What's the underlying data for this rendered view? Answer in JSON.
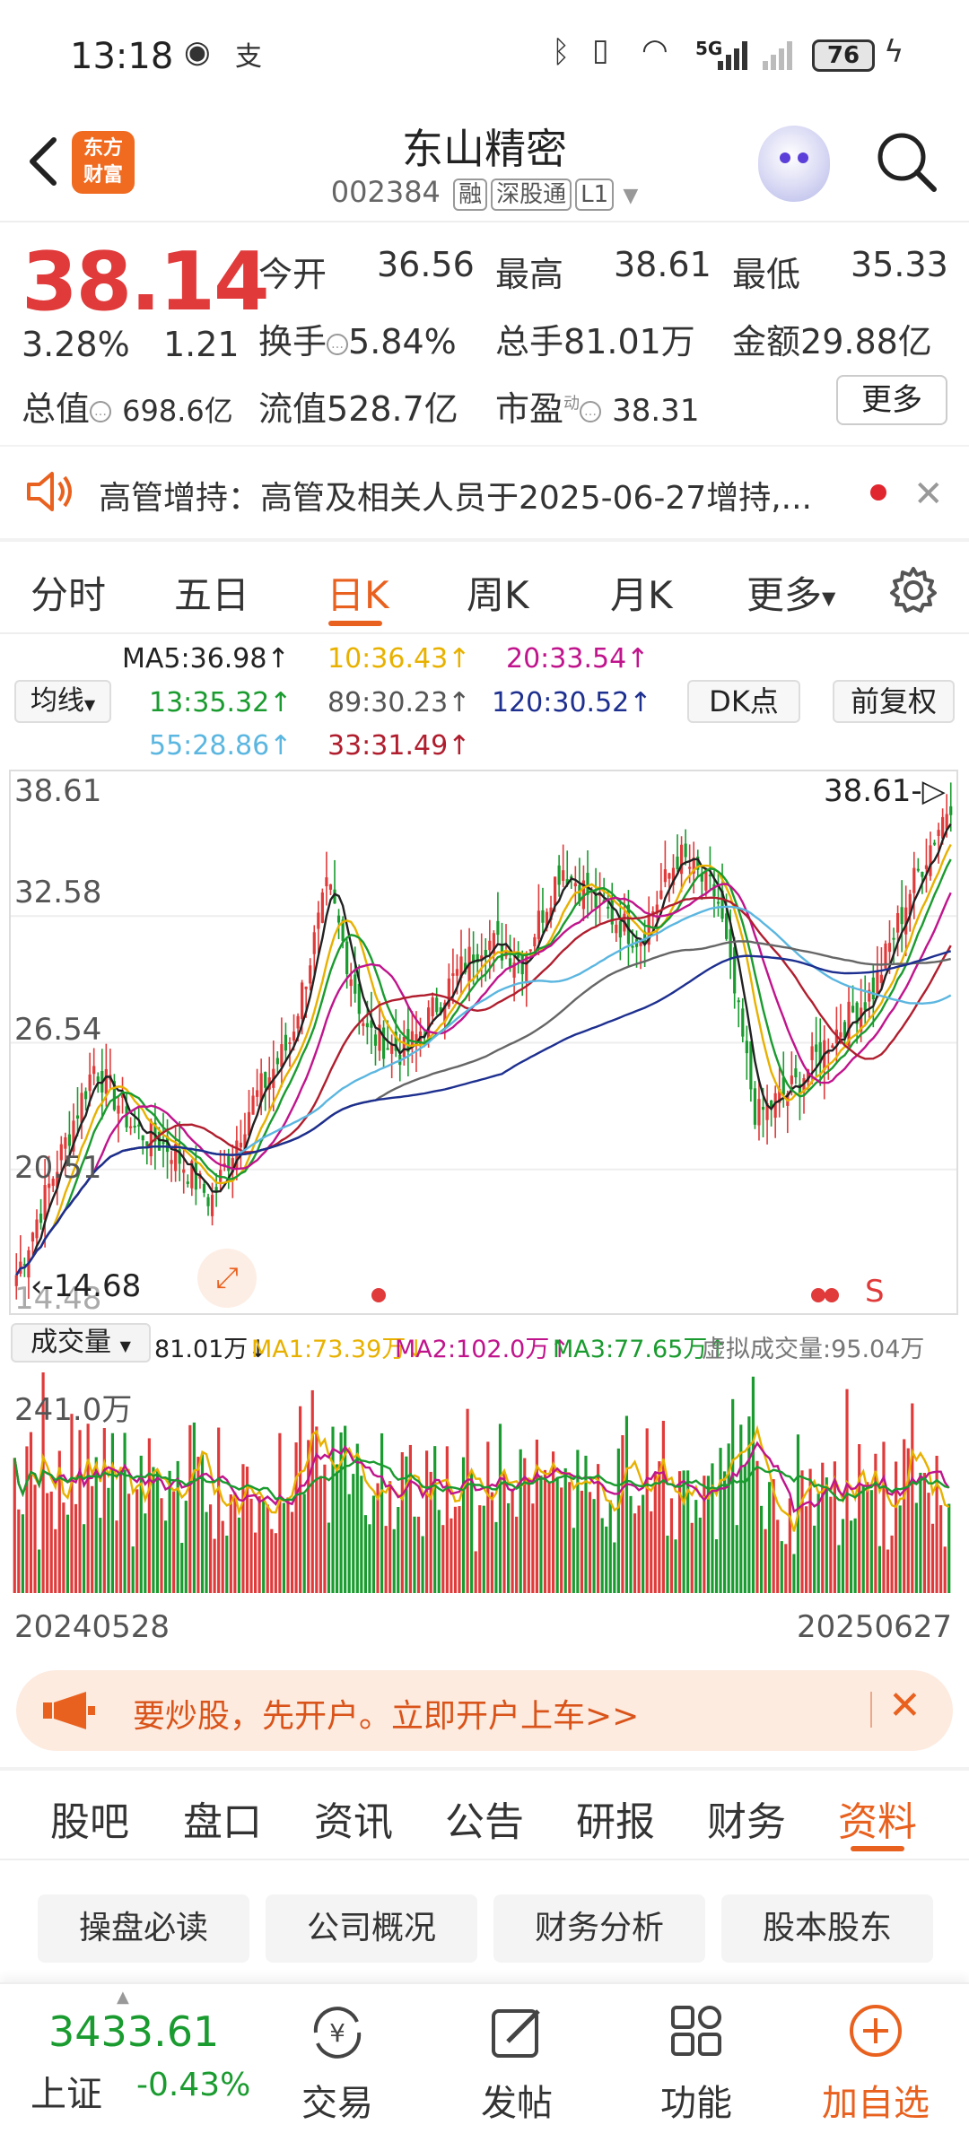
{
  "status_bar": {
    "time": "13:18",
    "battery": "76",
    "network": "5G"
  },
  "header": {
    "app_logo": "东方\n财富",
    "stock_name": "东山精密",
    "stock_code": "002384",
    "tags": [
      "融",
      "深股通",
      "L1"
    ]
  },
  "quote": {
    "price": "38.14",
    "change_pct": "3.28%",
    "change_amt": "1.21",
    "open_label": "今开",
    "open": "36.56",
    "high_label": "最高",
    "high": "38.61",
    "low_label": "最低",
    "low": "35.33",
    "turnover_label": "换手",
    "turnover": "5.84%",
    "volume_label": "总手",
    "volume": "81.01万",
    "amount_label": "金额",
    "amount": "29.88亿",
    "mktcap_label": "总值",
    "mktcap": "698.6亿",
    "float_label": "流值",
    "float_cap": "528.7亿",
    "pe_label": "市盈",
    "pe_sup": "动",
    "pe": "38.31",
    "more_label": "更多"
  },
  "notice": {
    "text": "高管增持：高管及相关人员于2025-06-27增持,..."
  },
  "period_tabs": {
    "items": [
      "分时",
      "五日",
      "日K",
      "周K",
      "月K",
      "更多"
    ],
    "active": "日K"
  },
  "indicators": {
    "ma_button": "均线",
    "dk_button": "DK点",
    "adjust_button": "前复权",
    "ma5": "MA5:36.98↑",
    "ma10": "10:36.43↑",
    "ma20": "20:33.54↑",
    "ma13": "13:35.32↑",
    "ma89": "89:30.23↑",
    "ma120": "120:30.52↑",
    "ma55": "55:28.86↑",
    "ma33": "33:31.49↑"
  },
  "chart_data": {
    "type": "candlestick",
    "y_ticks": [
      "38.61",
      "32.58",
      "26.54",
      "20.51",
      "14.48"
    ],
    "ylim": [
      14.48,
      38.61
    ],
    "high_marker": "38.61",
    "low_marker": "14.68",
    "signal_mark": "S",
    "x_range": [
      "20240528",
      "20250627"
    ],
    "approx_close_trend": [
      15.5,
      20.5,
      25.5,
      22.5,
      21.5,
      19.0,
      23.5,
      26.5,
      34.0,
      27.0,
      26.0,
      29.0,
      31.5,
      30.5,
      35.0,
      33.0,
      31.5,
      35.5,
      33.5,
      23.0,
      24.5,
      27.0,
      29.0,
      34.0,
      38.14
    ]
  },
  "volume": {
    "selector": "成交量",
    "vol": "81.01万↓",
    "ma1": "MA1:73.39万↓",
    "ma2": "MA2:102.0万↑",
    "ma3": "MA3:77.65万↑",
    "virtual": "虚拟成交量:95.04万",
    "max_label": "241.0万",
    "start_date": "20240528",
    "end_date": "20250627"
  },
  "banner": {
    "text": "要炒股，先开户。立即开户上车>>"
  },
  "info_tabs": {
    "items": [
      "股吧",
      "盘口",
      "资讯",
      "公告",
      "研报",
      "财务",
      "资料"
    ],
    "active": "资料"
  },
  "info_pills": [
    "操盘必读",
    "公司概况",
    "财务分析",
    "股本股东"
  ],
  "footer": {
    "index_value": "3433.61",
    "index_name": "上证",
    "index_change": "-0.43%",
    "items": [
      "交易",
      "发帖",
      "功能",
      "加自选"
    ]
  },
  "colors": {
    "up": "#e03a3a",
    "down": "#1a9b2f",
    "accent": "#e9611f"
  }
}
